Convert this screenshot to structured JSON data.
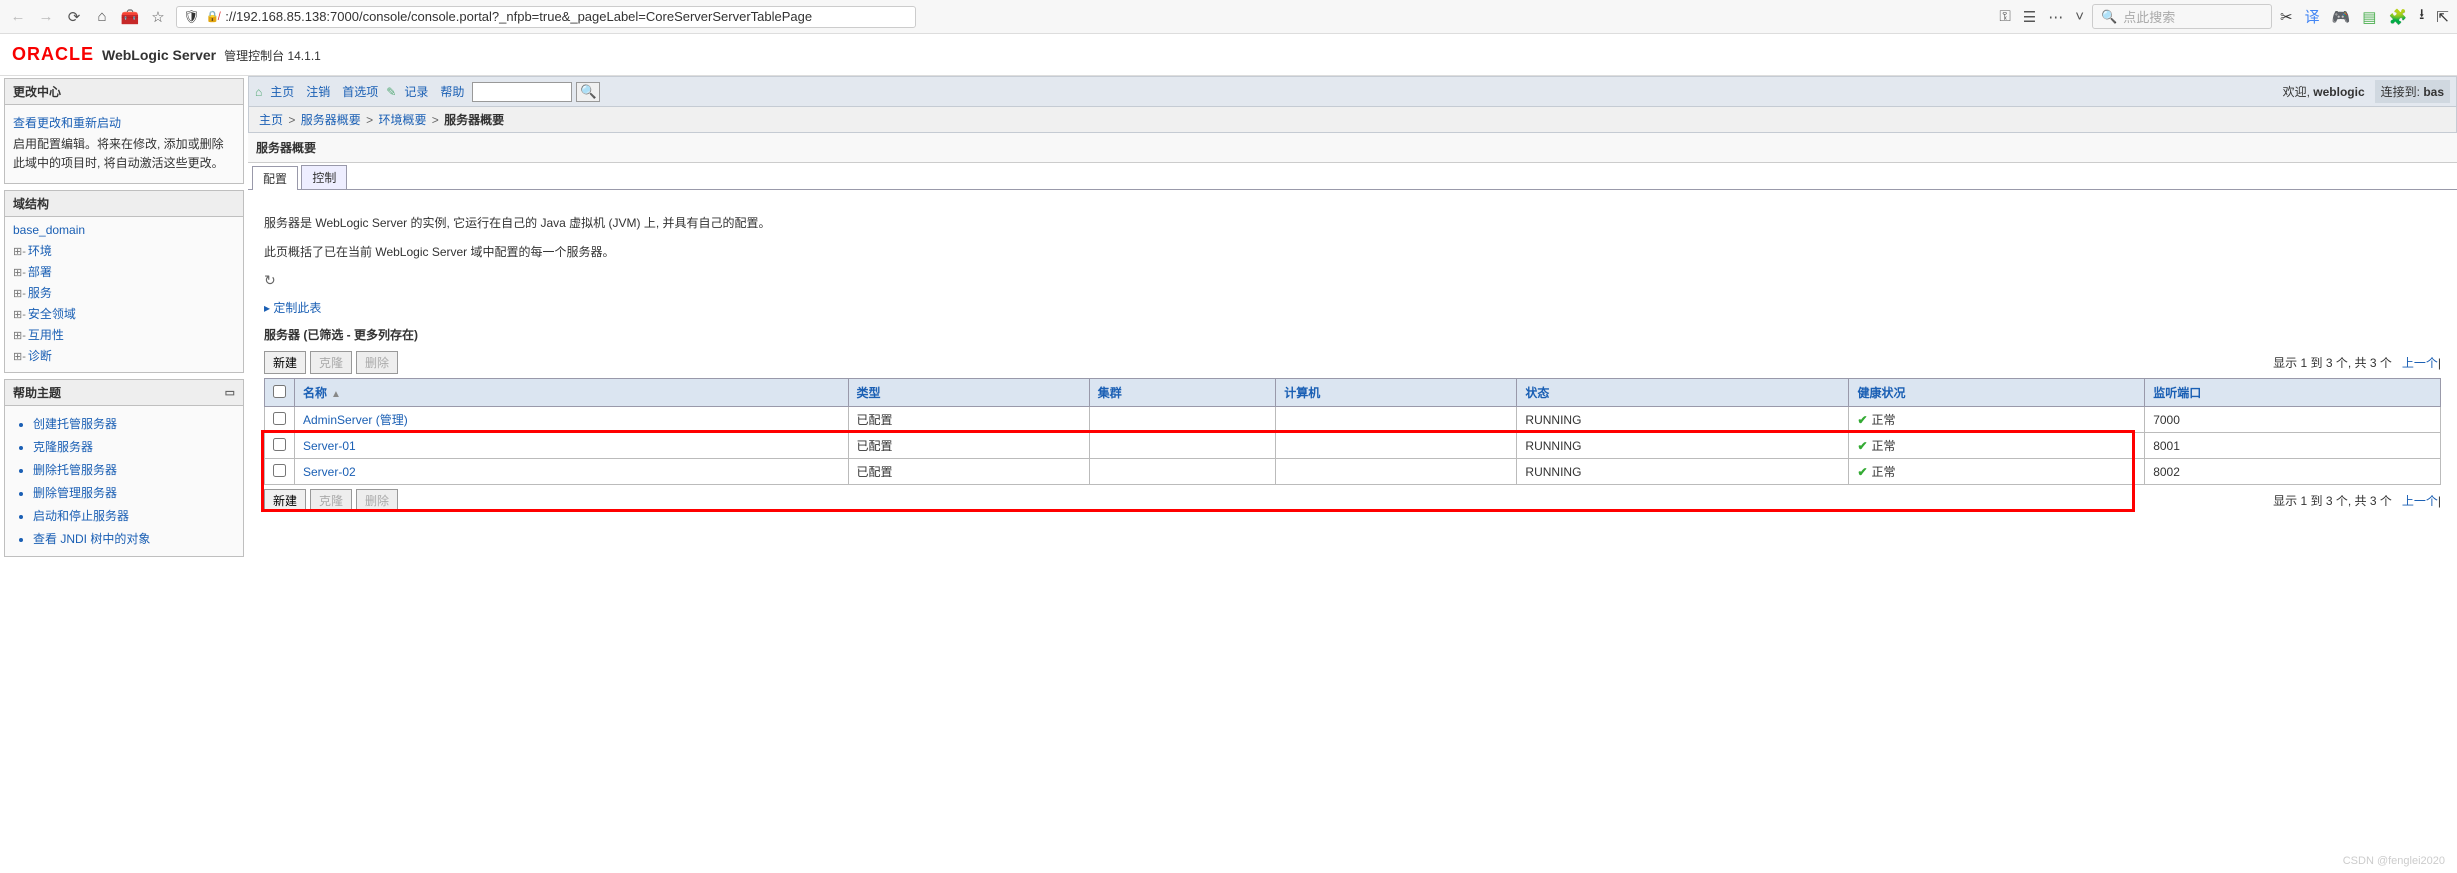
{
  "browser": {
    "url": "://192.168.85.138:7000/console/console.portal?_nfpb=true&_pageLabel=CoreServerServerTablePage",
    "search_placeholder": "点此搜索"
  },
  "header": {
    "oracle": "ORACLE",
    "product": "WebLogic Server",
    "console_title": "管理控制台 14.1.1"
  },
  "panels": {
    "change_center": {
      "title": "更改中心",
      "view_link": "查看更改和重新启动",
      "note": "启用配置编辑。将来在修改, 添加或删除此域中的项目时, 将自动激活这些更改。"
    },
    "domain_structure": {
      "title": "域结构",
      "root": "base_domain",
      "items": [
        "环境",
        "部署",
        "服务",
        "安全领域",
        "互用性",
        "诊断"
      ]
    },
    "help": {
      "title": "帮助主题",
      "items": [
        "创建托管服务器",
        "克隆服务器",
        "删除托管服务器",
        "删除管理服务器",
        "启动和停止服务器",
        "查看 JNDI 树中的对象"
      ]
    }
  },
  "toolbar": {
    "home": "主页",
    "logout": "注销",
    "prefs": "首选项",
    "record": "记录",
    "help": "帮助",
    "welcome_prefix": "欢迎,",
    "welcome_user": "weblogic",
    "connected_label": "连接到:",
    "connected_domain": "bas"
  },
  "breadcrumb": {
    "home": "主页",
    "items": [
      "服务器概要",
      "环境概要"
    ],
    "current": "服务器概要"
  },
  "page": {
    "title": "服务器概要",
    "tabs": {
      "config": "配置",
      "control": "控制"
    },
    "desc1": "服务器是 WebLogic Server 的实例, 它运行在自己的 Java 虚拟机 (JVM) 上, 并具有自己的配置。",
    "desc2": "此页概括了已在当前 WebLogic Server 域中配置的每一个服务器。",
    "refresh": "↻",
    "custom": "定制此表",
    "table_title": "服务器 (已筛选 - 更多列存在)",
    "new": "新建",
    "clone": "克隆",
    "delete": "删除",
    "page_info": "显示 1 到 3 个, 共 3 个",
    "prev": "上一个",
    "columns": {
      "name": "名称",
      "type": "类型",
      "cluster": "集群",
      "machine": "计算机",
      "state": "状态",
      "health": "健康状况",
      "port": "监听端口"
    },
    "rows": [
      {
        "name": "AdminServer (管理)",
        "type": "已配置",
        "cluster": "",
        "machine": "",
        "state": "RUNNING",
        "health": "正常",
        "port": "7000"
      },
      {
        "name": "Server-01",
        "type": "已配置",
        "cluster": "",
        "machine": "",
        "state": "RUNNING",
        "health": "正常",
        "port": "8001"
      },
      {
        "name": "Server-02",
        "type": "已配置",
        "cluster": "",
        "machine": "",
        "state": "RUNNING",
        "health": "正常",
        "port": "8002"
      }
    ]
  },
  "watermark": "CSDN @fenglei2020"
}
